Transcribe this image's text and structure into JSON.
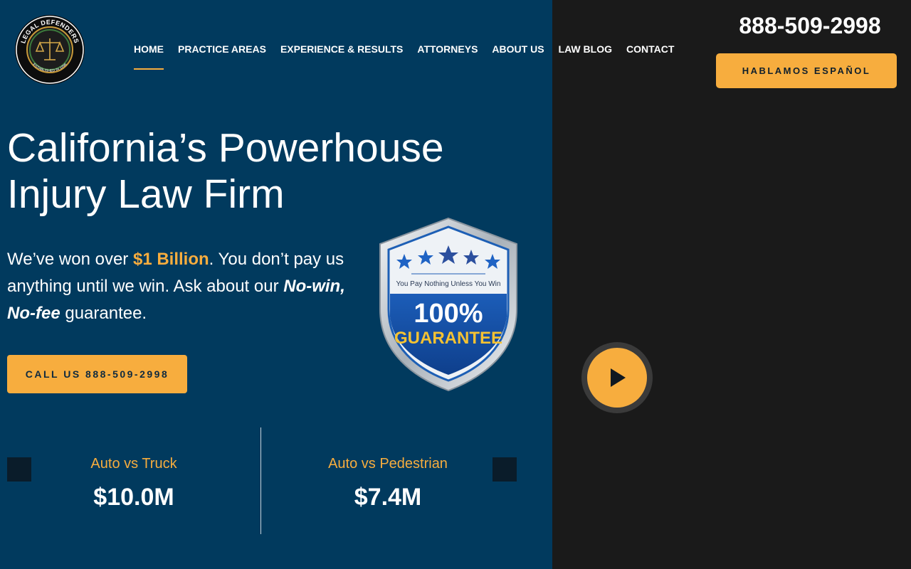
{
  "logo": {
    "ring_text_top": "LEGAL DEFENDERS",
    "ring_text_bottom": "ESTABLISHED IN 1996"
  },
  "nav": {
    "items": [
      {
        "label": "HOME",
        "active": true
      },
      {
        "label": "PRACTICE AREAS"
      },
      {
        "label": "EXPERIENCE & RESULTS"
      },
      {
        "label": "ATTORNEYS"
      },
      {
        "label": "ABOUT US"
      },
      {
        "label": "LAW BLOG"
      },
      {
        "label": "CONTACT"
      }
    ]
  },
  "header": {
    "phone": "888-509-2998",
    "spanish_label": "HABLAMOS ESPAÑOL"
  },
  "hero": {
    "title_line1": "California’s Powerhouse",
    "title_line2": "Injury Law Firm",
    "text_part1": "We’ve won over ",
    "text_accent": "$1 Billion",
    "text_part2": ". You don’t pay us anything until we win. Ask about our ",
    "text_em": "No-win, No-fee",
    "text_part3": " guarantee.",
    "call_label": "CALL US 888-509-2998"
  },
  "badge": {
    "tagline": "You Pay Nothing Unless You Win",
    "percent": "100%",
    "word": "GUARANTEE"
  },
  "results": {
    "prev_icon": "",
    "next_icon": "",
    "items": [
      {
        "label": "Auto vs Truck",
        "amount": "$10.0M"
      },
      {
        "label": "Auto vs Pedestrian",
        "amount": "$7.4M"
      }
    ]
  },
  "colors": {
    "navy": "#013a5e",
    "accent": "#f7ad3e",
    "dark": "#1a1a1a"
  },
  "icons": {
    "play": "play-icon",
    "scales": "scales-of-justice-icon"
  }
}
